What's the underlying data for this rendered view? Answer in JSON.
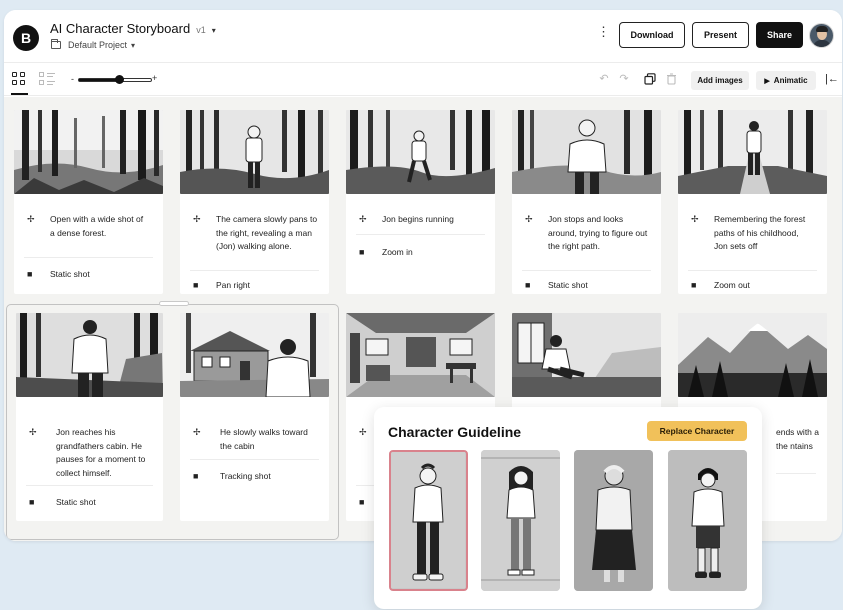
{
  "header": {
    "title": "AI Character Storyboard",
    "version": "v1",
    "project": "Default Project",
    "buttons": {
      "download": "Download",
      "present": "Present",
      "share": "Share"
    },
    "logo_letter": "B"
  },
  "toolbar": {
    "zoom_minus": "-",
    "zoom_plus": "+",
    "zoom_level": 0.55,
    "add_images": "Add images",
    "animatic": "Animatic"
  },
  "storyboard": {
    "frames": [
      {
        "action": "Open with a wide shot of a dense forest.",
        "shot": "Static shot"
      },
      {
        "action": "The camera slowly pans to the right, revealing a man (Jon) walking alone.",
        "shot": "Pan right"
      },
      {
        "action": "Jon begins running",
        "shot": "Zoom in"
      },
      {
        "action": "Jon stops and looks around, trying to figure out the right path.",
        "shot": "Static shot"
      },
      {
        "action": "Remembering the forest paths of his childhood, Jon sets off",
        "shot": "Zoom out"
      },
      {
        "action": "Jon reaches his grandfathers cabin. He pauses for a moment to collect himself.",
        "shot": "Static shot"
      },
      {
        "action": "He slowly walks toward the cabin",
        "shot": "Tracking shot"
      },
      {
        "action": "",
        "shot": ""
      },
      {
        "action": "",
        "shot": ""
      },
      {
        "action": "ends with a the ntains",
        "shot": ""
      }
    ]
  },
  "guideline": {
    "title": "Character Guideline",
    "replace_label": "Replace Character",
    "selected_index": 0
  },
  "colors": {
    "accent_yellow": "#f1c15a",
    "selected_pink": "#d9828c",
    "ink": "#111111"
  }
}
